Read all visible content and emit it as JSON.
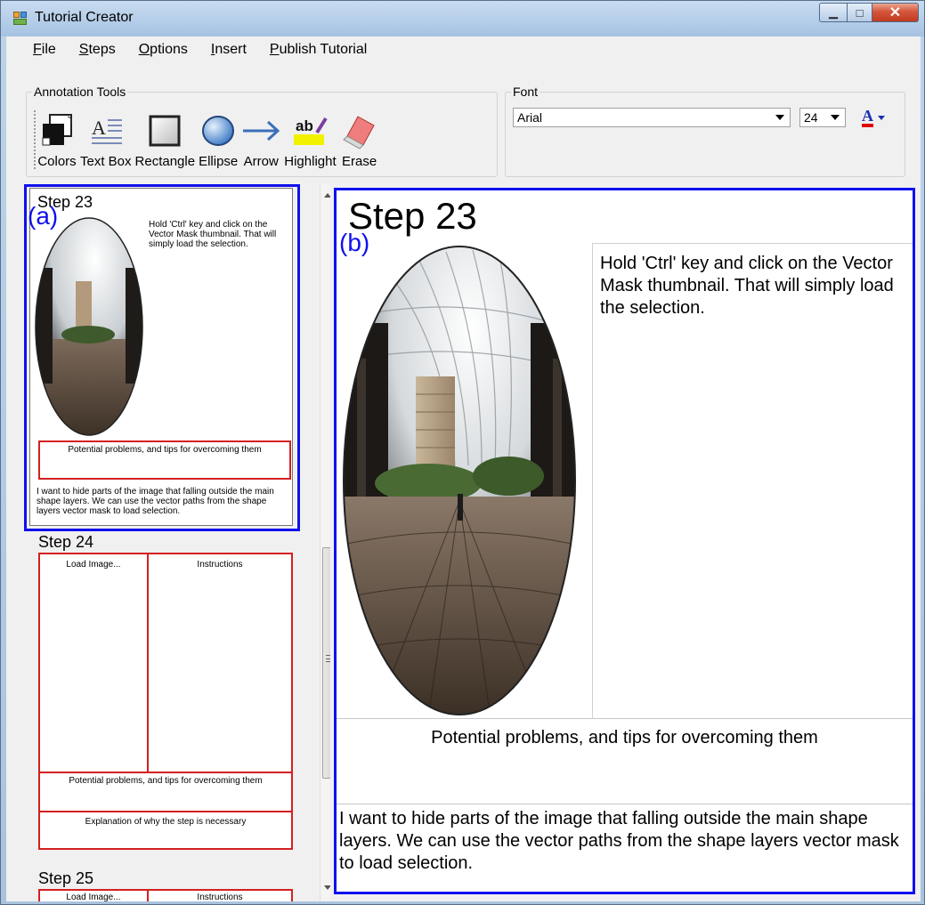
{
  "window": {
    "title": "Tutorial Creator"
  },
  "menu": {
    "items": [
      {
        "accel": "F",
        "rest": "ile"
      },
      {
        "accel": "S",
        "rest": "teps"
      },
      {
        "accel": "O",
        "rest": "ptions"
      },
      {
        "accel": "I",
        "rest": "nsert"
      },
      {
        "accel": "P",
        "rest": "ublish Tutorial"
      }
    ]
  },
  "annotation_tools": {
    "label": "Annotation Tools",
    "tools": [
      "Colors",
      "Text Box",
      "Rectangle",
      "Ellipse",
      "Arrow",
      "Highlight",
      "Erase"
    ]
  },
  "font": {
    "label": "Font",
    "family": "Arial",
    "size": "24",
    "color_glyph": "A"
  },
  "labels": {
    "a": "(a)",
    "b": "(b)"
  },
  "thumbnails": [
    {
      "title": "Step 23",
      "instructions": "Hold 'Ctrl' key and click on the Vector Mask thumbnail. That will simply load the selection.",
      "problems": "Potential problems, and tips for overcoming them",
      "explanation": "I want to hide parts of the image that falling outside the main shape layers. We can use the vector paths from the shape layers vector mask to load selection."
    },
    {
      "title": "Step 24",
      "load_image": "Load Image...",
      "instructions": "Instructions",
      "problems": "Potential problems, and tips for overcoming them",
      "explanation": "Explanation of why the step is necessary"
    },
    {
      "title": "Step 25",
      "load_image": "Load Image...",
      "instructions": "Instructions"
    }
  ],
  "main_step": {
    "title": "Step 23",
    "instructions": "Hold 'Ctrl' key and click on the Vector Mask thumbnail. That will simply load the selection.",
    "problems": "Potential problems, and tips for overcoming them",
    "explanation": "I want to hide parts of the image that falling outside the main shape layers. We can use the vector paths from the shape layers vector mask to load selection."
  },
  "colors": {
    "annotation_blue": "#1010ee",
    "annotation_red": "#d42020"
  }
}
